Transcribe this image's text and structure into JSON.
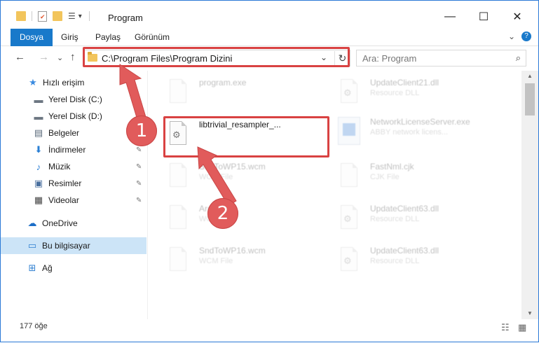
{
  "window": {
    "title": "Program",
    "minimize_glyph": "—",
    "maximize_glyph": "☐",
    "close_glyph": "✕"
  },
  "quick_access": {
    "icons": [
      "folder-icon",
      "properties-icon",
      "new-folder-icon",
      "customize-icon"
    ],
    "dropdown_glyph": "▾"
  },
  "ribbon": {
    "tabs": [
      "Dosya",
      "Giriş",
      "Paylaş",
      "Görünüm"
    ],
    "expand_glyph": "⌄",
    "help_glyph": "?"
  },
  "nav": {
    "back_glyph": "←",
    "forward_glyph": "→",
    "recent_glyph": "⌄",
    "up_glyph": "↑"
  },
  "address": {
    "path": "C:\\Program Files\\Program Dizini",
    "dropdown_glyph": "⌄",
    "refresh_glyph": "↻"
  },
  "search": {
    "placeholder": "Ara: Program",
    "icon_glyph": "⌕"
  },
  "sidebar": {
    "items": [
      {
        "label": "Hızlı erişim",
        "icon": "star-icon",
        "glyph": "★",
        "color": "#3a8be0",
        "pinned": false
      },
      {
        "label": "Yerel Disk (C:)",
        "icon": "drive-icon",
        "glyph": "▬",
        "color": "#6d7782",
        "pinned": true
      },
      {
        "label": "Yerel Disk (D:)",
        "icon": "drive-icon",
        "glyph": "▬",
        "color": "#6d7782",
        "pinned": true
      },
      {
        "label": "Belgeler",
        "icon": "documents-icon",
        "glyph": "▤",
        "color": "#5a6a7a",
        "pinned": true
      },
      {
        "label": "İndirmeler",
        "icon": "download-icon",
        "glyph": "⬇",
        "color": "#2a7fd4",
        "pinned": true
      },
      {
        "label": "Müzik",
        "icon": "music-icon",
        "glyph": "♪",
        "color": "#2a7fd4",
        "pinned": true
      },
      {
        "label": "Resimler",
        "icon": "pictures-icon",
        "glyph": "▣",
        "color": "#4a6f9e",
        "pinned": true
      },
      {
        "label": "Videolar",
        "icon": "video-icon",
        "glyph": "▦",
        "color": "#444444",
        "pinned": true
      },
      {
        "label": "OneDrive",
        "icon": "cloud-icon",
        "glyph": "☁",
        "color": "#1c6ec7",
        "pinned": false
      },
      {
        "label": "Bu bilgisayar",
        "icon": "computer-icon",
        "glyph": "▭",
        "color": "#2f7fd0",
        "pinned": false
      },
      {
        "label": "Ağ",
        "icon": "network-icon",
        "glyph": "⊞",
        "color": "#2f7fd0",
        "pinned": false
      }
    ],
    "pin_glyph": "✎"
  },
  "files": [
    {
      "name": "program.exe",
      "type": "",
      "faded": true
    },
    {
      "name": "UpdateClient21.dll",
      "type": "Resource DLL",
      "faded": true
    },
    {
      "name": "libtrivial_resampler_...",
      "type": "",
      "faded": false
    },
    {
      "name": "NetworkLicenseServer.exe",
      "type": "ABBY network licens...",
      "faded": true
    },
    {
      "name": "SndToWP15.wcm",
      "type": "WCM File",
      "faded": true
    },
    {
      "name": "FastNml.cjk",
      "type": "CJK File",
      "faded": true
    },
    {
      "name": "Archived",
      "type": "WCM File",
      "faded": true
    },
    {
      "name": "UpdateClient63.dll",
      "type": "Resource DLL",
      "faded": true
    },
    {
      "name": "SndToWP16.wcm",
      "type": "WCM File",
      "faded": true
    },
    {
      "name": "UpdateClient63.dll",
      "type": "Resource DLL",
      "faded": true
    }
  ],
  "status": {
    "item_count": "177 öğe"
  },
  "annotations": {
    "step1": "1",
    "step2": "2",
    "accent_color": "#e15b5b"
  }
}
